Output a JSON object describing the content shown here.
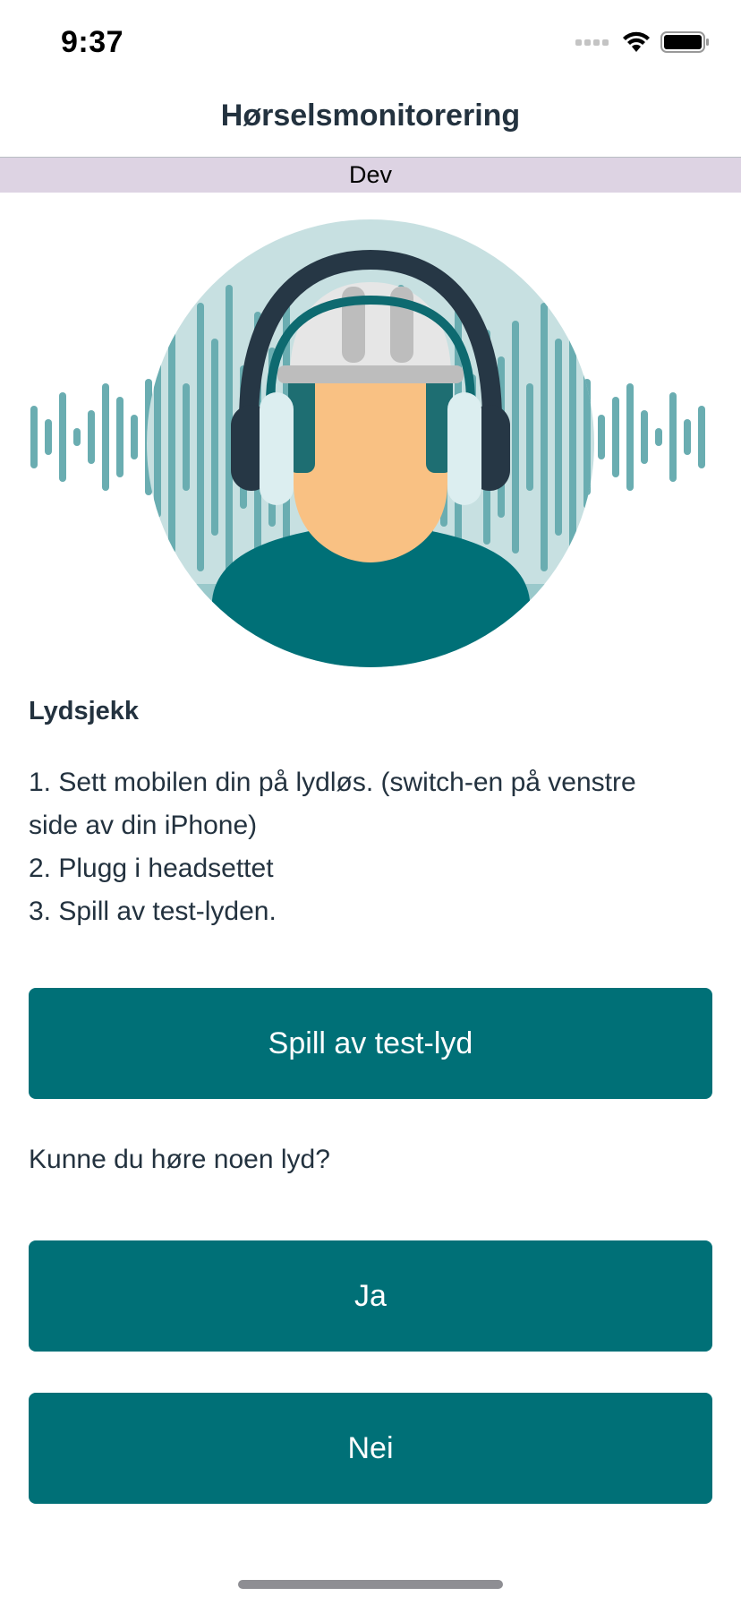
{
  "status_bar": {
    "time": "9:37",
    "icons": [
      "signal-icon",
      "wifi-icon",
      "battery-icon"
    ]
  },
  "nav": {
    "title": "Hørselsmonitorering"
  },
  "environment_banner": {
    "label": "Dev",
    "color": "#ddd3e3"
  },
  "hero": {
    "image": "worker-with-headphones-illustration"
  },
  "content": {
    "section_title": "Lydsjekk",
    "instructions": [
      "1. Sett mobilen din på lydløs. (switch-en på venstre",
      "side av din iPhone)",
      "2. Plugg i headsettet",
      "3. Spill av test-lyden."
    ],
    "play_button_label": "Spill av test-lyd",
    "question": "Kunne du høre noen lyd?",
    "yes_button_label": "Ja",
    "no_button_label": "Nei"
  },
  "colors": {
    "primary": "#007077",
    "text": "#23323f",
    "circle_bg": "#c7e0e1",
    "wave": "#6aadb1"
  }
}
